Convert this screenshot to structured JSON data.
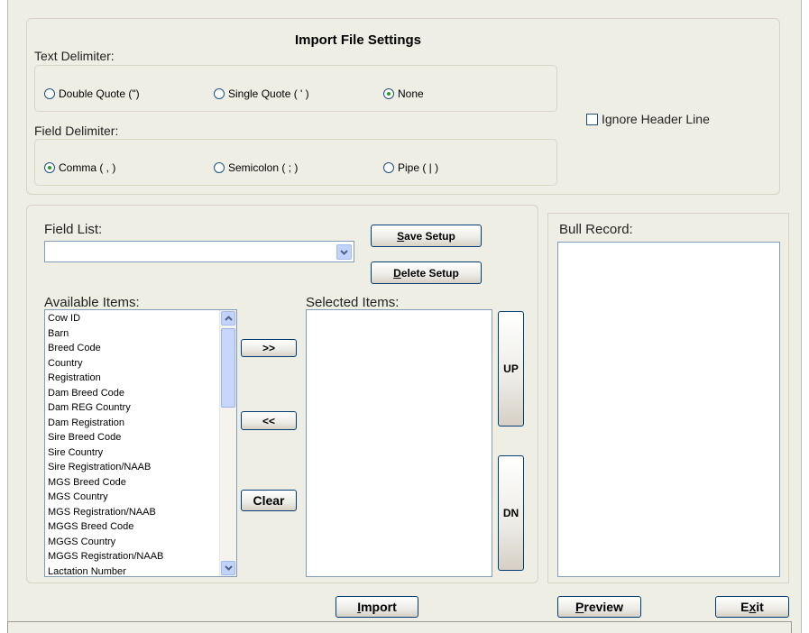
{
  "import_settings": {
    "title": "Import File Settings",
    "text_delimiter": {
      "label": "Text Delimiter:",
      "options": [
        {
          "label": "Double Quote (\")",
          "selected": false
        },
        {
          "label": "Single Quote  ( ' )",
          "selected": false
        },
        {
          "label": "None",
          "selected": true
        }
      ]
    },
    "field_delimiter": {
      "label": "Field Delimiter:",
      "options": [
        {
          "label": "Comma ( , )",
          "selected": true
        },
        {
          "label": "Semicolon ( ; )",
          "selected": false
        },
        {
          "label": "Pipe ( | )",
          "selected": false
        }
      ]
    },
    "ignore_header": {
      "label": "Ignore Header Line",
      "checked": false
    }
  },
  "field_list": {
    "label": "Field List:",
    "value": "",
    "save_setup": {
      "accel": "S",
      "rest": "ave Setup"
    },
    "delete_setup": {
      "accel": "D",
      "rest": "elete Setup"
    }
  },
  "available": {
    "label": "Available Items:",
    "items": [
      "Cow ID",
      "Barn",
      "Breed Code",
      "Country",
      "Registration",
      "Dam Breed Code",
      "Dam REG Country",
      "Dam Registration",
      "Sire Breed Code",
      "Sire Country",
      "Sire Registration/NAAB",
      "MGS Breed Code",
      "MGS Country",
      "MGS Registration/NAAB",
      "MGGS Breed Code",
      "MGGS Country",
      "MGGS Registration/NAAB",
      "Lactation Number"
    ]
  },
  "transfer": {
    "add": ">>",
    "remove": "<<",
    "clear": "Clear"
  },
  "selected": {
    "label": "Selected Items:",
    "items": []
  },
  "order": {
    "up": "UP",
    "down": "DN"
  },
  "bull_record": {
    "label": "Bull Record:"
  },
  "footer": {
    "import": {
      "accel": "I",
      "rest": "mport"
    },
    "preview": {
      "accel": "P",
      "rest": "review"
    },
    "exit": {
      "pre": "E",
      "accel": "x",
      "rest": "it"
    }
  },
  "colors": {
    "window_bg": "#efeee4",
    "radio_dot": "#21a121",
    "button_border": "#003c74"
  }
}
